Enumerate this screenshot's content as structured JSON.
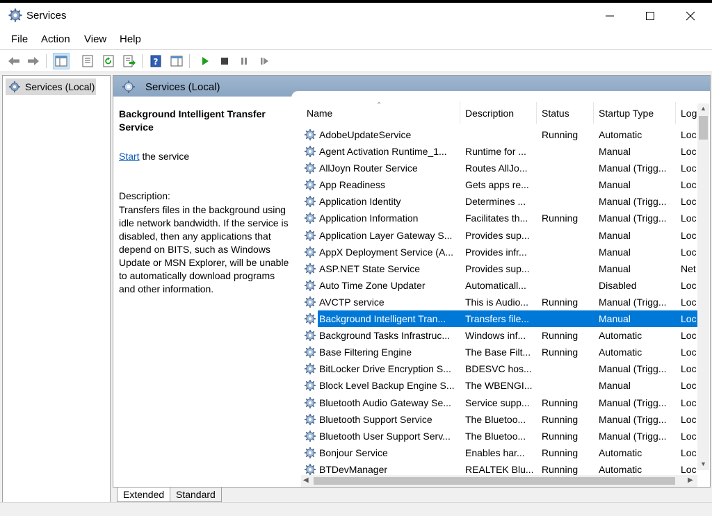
{
  "window": {
    "title": "Services",
    "icon": "services-gear-icon"
  },
  "menu": [
    "File",
    "Action",
    "View",
    "Help"
  ],
  "tree": {
    "item": "Services (Local)"
  },
  "pane": {
    "header": "Services (Local)"
  },
  "detail": {
    "name": "Background Intelligent Transfer Service",
    "action_link": "Start",
    "action_rest": " the service",
    "description_label": "Description:",
    "description": "Transfers files in the background using idle network bandwidth. If the service is disabled, then any applications that depend on BITS, such as Windows Update or MSN Explorer, will be unable to automatically download programs and other information."
  },
  "columns": {
    "name": "Name",
    "description": "Description",
    "status": "Status",
    "startup": "Startup Type",
    "logon": "Log"
  },
  "rows": [
    {
      "name": "AdobeUpdateService",
      "description": "",
      "status": "Running",
      "startup": "Automatic",
      "logon": "Loc"
    },
    {
      "name": "Agent Activation Runtime_1...",
      "description": "Runtime for ...",
      "status": "",
      "startup": "Manual",
      "logon": "Loc"
    },
    {
      "name": "AllJoyn Router Service",
      "description": "Routes AllJo...",
      "status": "",
      "startup": "Manual (Trigg...",
      "logon": "Loc"
    },
    {
      "name": "App Readiness",
      "description": "Gets apps re...",
      "status": "",
      "startup": "Manual",
      "logon": "Loc"
    },
    {
      "name": "Application Identity",
      "description": "Determines ...",
      "status": "",
      "startup": "Manual (Trigg...",
      "logon": "Loc"
    },
    {
      "name": "Application Information",
      "description": "Facilitates th...",
      "status": "Running",
      "startup": "Manual (Trigg...",
      "logon": "Loc"
    },
    {
      "name": "Application Layer Gateway S...",
      "description": "Provides sup...",
      "status": "",
      "startup": "Manual",
      "logon": "Loc"
    },
    {
      "name": "AppX Deployment Service (A...",
      "description": "Provides infr...",
      "status": "",
      "startup": "Manual",
      "logon": "Loc"
    },
    {
      "name": "ASP.NET State Service",
      "description": "Provides sup...",
      "status": "",
      "startup": "Manual",
      "logon": "Net"
    },
    {
      "name": "Auto Time Zone Updater",
      "description": "Automaticall...",
      "status": "",
      "startup": "Disabled",
      "logon": "Loc"
    },
    {
      "name": "AVCTP service",
      "description": "This is Audio...",
      "status": "Running",
      "startup": "Manual (Trigg...",
      "logon": "Loc"
    },
    {
      "name": "Background Intelligent Tran...",
      "description": "Transfers file...",
      "status": "",
      "startup": "Manual",
      "logon": "Loc",
      "selected": true
    },
    {
      "name": "Background Tasks Infrastruc...",
      "description": "Windows inf...",
      "status": "Running",
      "startup": "Automatic",
      "logon": "Loc"
    },
    {
      "name": "Base Filtering Engine",
      "description": "The Base Filt...",
      "status": "Running",
      "startup": "Automatic",
      "logon": "Loc"
    },
    {
      "name": "BitLocker Drive Encryption S...",
      "description": "BDESVC hos...",
      "status": "",
      "startup": "Manual (Trigg...",
      "logon": "Loc"
    },
    {
      "name": "Block Level Backup Engine S...",
      "description": "The WBENGI...",
      "status": "",
      "startup": "Manual",
      "logon": "Loc"
    },
    {
      "name": "Bluetooth Audio Gateway Se...",
      "description": "Service supp...",
      "status": "Running",
      "startup": "Manual (Trigg...",
      "logon": "Loc"
    },
    {
      "name": "Bluetooth Support Service",
      "description": "The Bluetoo...",
      "status": "Running",
      "startup": "Manual (Trigg...",
      "logon": "Loc"
    },
    {
      "name": "Bluetooth User Support Serv...",
      "description": "The Bluetoo...",
      "status": "Running",
      "startup": "Manual (Trigg...",
      "logon": "Loc"
    },
    {
      "name": "Bonjour Service",
      "description": "Enables har...",
      "status": "Running",
      "startup": "Automatic",
      "logon": "Loc"
    },
    {
      "name": "BTDevManager",
      "description": "REALTEK Blu...",
      "status": "Running",
      "startup": "Automatic",
      "logon": "Loc"
    }
  ],
  "tabs": {
    "extended": "Extended",
    "standard": "Standard"
  },
  "colors": {
    "selection": "#0078d7",
    "header_band": "#9fb6cf",
    "link": "#0b5db8",
    "play_green": "#1aa11a"
  }
}
